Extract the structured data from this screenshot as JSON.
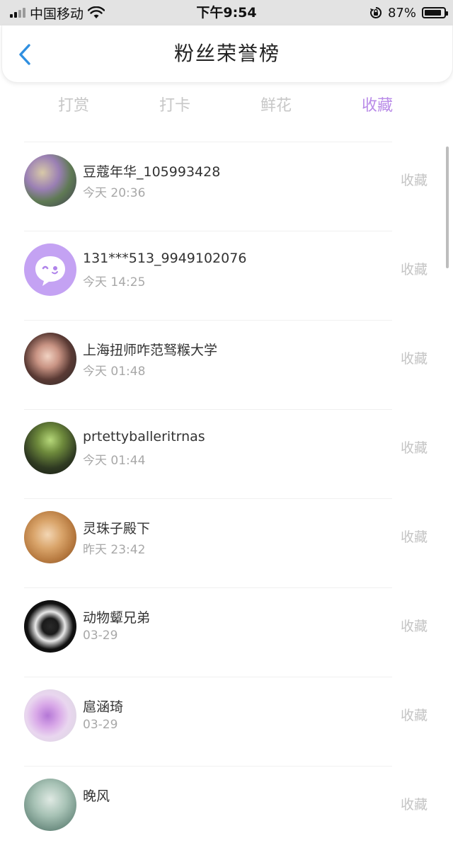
{
  "status_bar": {
    "carrier": "中国移动",
    "time": "下午9:54",
    "battery_percent": "87%",
    "battery_level": 0.87,
    "signal_bars_active": 2,
    "signal_bars_total": 4
  },
  "header": {
    "title": "粉丝荣誉榜",
    "back_icon": "chevron-left-icon"
  },
  "tabs": [
    {
      "label": "打赏",
      "active": false
    },
    {
      "label": "打卡",
      "active": false
    },
    {
      "label": "鲜花",
      "active": false
    },
    {
      "label": "收藏",
      "active": true
    }
  ],
  "colors": {
    "accent": "#b98be8",
    "back_arrow": "#2f8fe0",
    "inactive_tab": "#c7c7c7"
  },
  "fans": [
    {
      "name": "豆蔻年华_105993428",
      "time": "今天 20:36",
      "action": "收藏"
    },
    {
      "name": "131***513_9949102076",
      "time": "今天 14:25",
      "action": "收藏"
    },
    {
      "name": "上海扭师咋范驽糇大学",
      "time": "今天 01:48",
      "action": "收藏"
    },
    {
      "name": "prtettyballeritrnas",
      "time": "今天 01:44",
      "action": "收藏"
    },
    {
      "name": "灵珠子殿下",
      "time": "昨天 23:42",
      "action": "收藏"
    },
    {
      "name": "动物颦兄弟",
      "time": "03-29",
      "action": "收藏"
    },
    {
      "name": "扈涵琦",
      "time": "03-29",
      "action": "收藏"
    },
    {
      "name": "晚风",
      "time": "",
      "action": "收藏"
    }
  ]
}
